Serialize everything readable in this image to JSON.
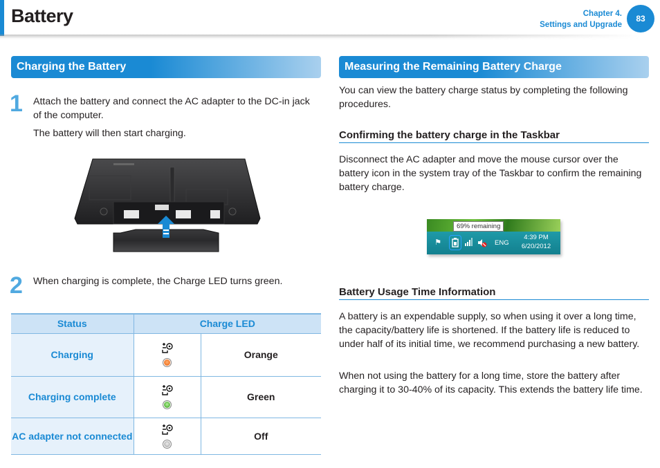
{
  "header": {
    "title": "Battery",
    "chapter_line1": "Chapter 4.",
    "chapter_line2": "Settings and Upgrade",
    "page_number": "83",
    "accent_color": "#1a8ad4"
  },
  "left": {
    "section_title": "Charging the Battery",
    "steps": [
      {
        "number": "1",
        "text": "Attach the battery and connect the AC adapter to the DC-in jack of the computer.",
        "note": "The battery will then start charging."
      },
      {
        "number": "2",
        "text": "When charging is complete, the Charge LED turns green."
      }
    ],
    "illustration": {
      "icon": "laptop-battery-insert-illustration",
      "arrow": "up-arrow"
    },
    "table": {
      "headers": [
        "Status",
        "Charge LED"
      ],
      "rows": [
        {
          "status": "Charging",
          "led_icon": "charge-led-icon",
          "led_color_hex": "#f07020",
          "color": "Orange"
        },
        {
          "status": "Charging complete",
          "led_icon": "charge-led-icon",
          "led_color_hex": "#4cb030",
          "color": "Green"
        },
        {
          "status": "AC adapter not connected",
          "led_icon": "charge-led-icon",
          "led_color_hex": "#b0b0b0",
          "color": "Off"
        }
      ]
    }
  },
  "right": {
    "section_title": "Measuring the Remaining Battery Charge",
    "intro": "You can view the battery charge status by completing the following procedures.",
    "taskbar_section": {
      "heading": "Confirming the battery charge in the Taskbar",
      "text": "Disconnect the AC adapter and move the mouse cursor over the battery icon in the system tray of the Taskbar to confirm the remaining battery charge.",
      "screenshot": {
        "tooltip": "69% remaining",
        "icons": [
          "flag-icon",
          "battery-icon",
          "signal-icon",
          "volume-muted-icon"
        ],
        "language": "ENG",
        "time": "4:39 PM",
        "date": "6/20/2012"
      }
    },
    "usage_section": {
      "heading": "Battery Usage Time Information",
      "paragraphs": [
        "A battery is an expendable supply, so when using it over a long time, the capacity/battery life is shortened. If the battery life is reduced to under half of its initial time, we recommend purchasing a new battery.",
        "When not using the battery for a long time, store the battery after charging it to 30-40% of its capacity. This extends the battery life time."
      ]
    }
  }
}
